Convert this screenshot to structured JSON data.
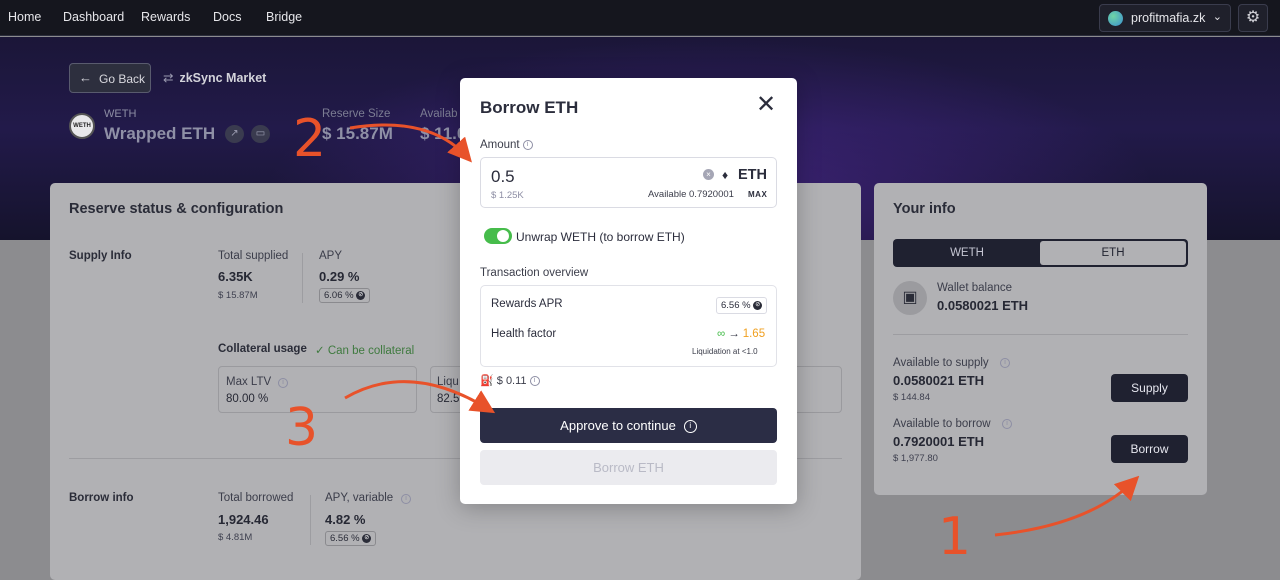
{
  "nav": {
    "items": [
      "Home",
      "Dashboard",
      "Rewards",
      "Docs",
      "Bridge"
    ]
  },
  "user": {
    "name": "profitmafia.zk",
    "chevron": "⌄"
  },
  "hero": {
    "go_back": "Go Back",
    "market": "zkSync Market",
    "asset_logo_text": "WETH",
    "asset_symbol": "WETH",
    "asset_name": "Wrapped ETH",
    "reserve_size_label": "Reserve Size",
    "reserve_size_value": "$ 15.87M",
    "available_label": "Availab",
    "available_value": "$ 11.0"
  },
  "reserve": {
    "title": "Reserve status & configuration",
    "supply_info_label": "Supply Info",
    "total_supplied_label": "Total supplied",
    "total_supplied_value": "6.35K",
    "total_supplied_usd": "$ 15.87M",
    "apy_label": "APY",
    "apy_value": "0.29 %",
    "apy_reward": "6.06 %",
    "collateral_usage_label": "Collateral usage",
    "can_be_collateral": "Can be collateral",
    "max_ltv_label": "Max LTV",
    "max_ltv_value": "80.00 %",
    "liq_label": "Liqu",
    "liq_value": "82.5",
    "borrow_info_label": "Borrow info",
    "total_borrowed_label": "Total borrowed",
    "total_borrowed_value": "1,924.46",
    "total_borrowed_usd": "$ 4.81M",
    "apy_variable_label": "APY, variable",
    "apy_variable_value": "4.82 %",
    "apy_variable_reward": "6.56 %"
  },
  "your_info": {
    "title": "Your info",
    "tabs": [
      "WETH",
      "ETH"
    ],
    "active_tab": "ETH",
    "wallet_balance_label": "Wallet balance",
    "wallet_balance_value": "0.0580021 ETH",
    "available_supply_label": "Available to supply",
    "available_supply_value": "0.0580021 ETH",
    "available_supply_usd": "$ 144.84",
    "supply_button": "Supply",
    "available_borrow_label": "Available to borrow",
    "available_borrow_value": "0.7920001 ETH",
    "available_borrow_usd": "$ 1,977.80",
    "borrow_button": "Borrow"
  },
  "modal": {
    "title": "Borrow ETH",
    "close": "✕",
    "amount_label": "Amount",
    "amount_value": "0.5",
    "amount_usd": "$ 1.25K",
    "token_symbol": "♦",
    "token": "ETH",
    "available": "Available 0.7920001",
    "max": "MAX",
    "unwrap_label": "Unwrap WETH (to borrow ETH)",
    "unwrap_enabled": true,
    "tx_overview_label": "Transaction overview",
    "rewards_apr_label": "Rewards APR",
    "rewards_apr_value": "6.56 %",
    "health_factor_label": "Health factor",
    "health_factor_from": "∞",
    "health_factor_arrow": "→",
    "health_factor_to": "1.65",
    "liquidation_note": "Liquidation at <1.0",
    "gas_cost": "$ 0.11",
    "approve_button": "Approve to continue",
    "borrow_button": "Borrow ETH"
  },
  "annotations": {
    "step1": "1",
    "step2": "2",
    "step3": "3",
    "arrow_color": "#e8522a"
  },
  "colors": {
    "accent_dark": "#2b2d45",
    "toggle_green": "#46bc4b",
    "health_orange": "#f0a020",
    "annotation": "#e8522a"
  }
}
